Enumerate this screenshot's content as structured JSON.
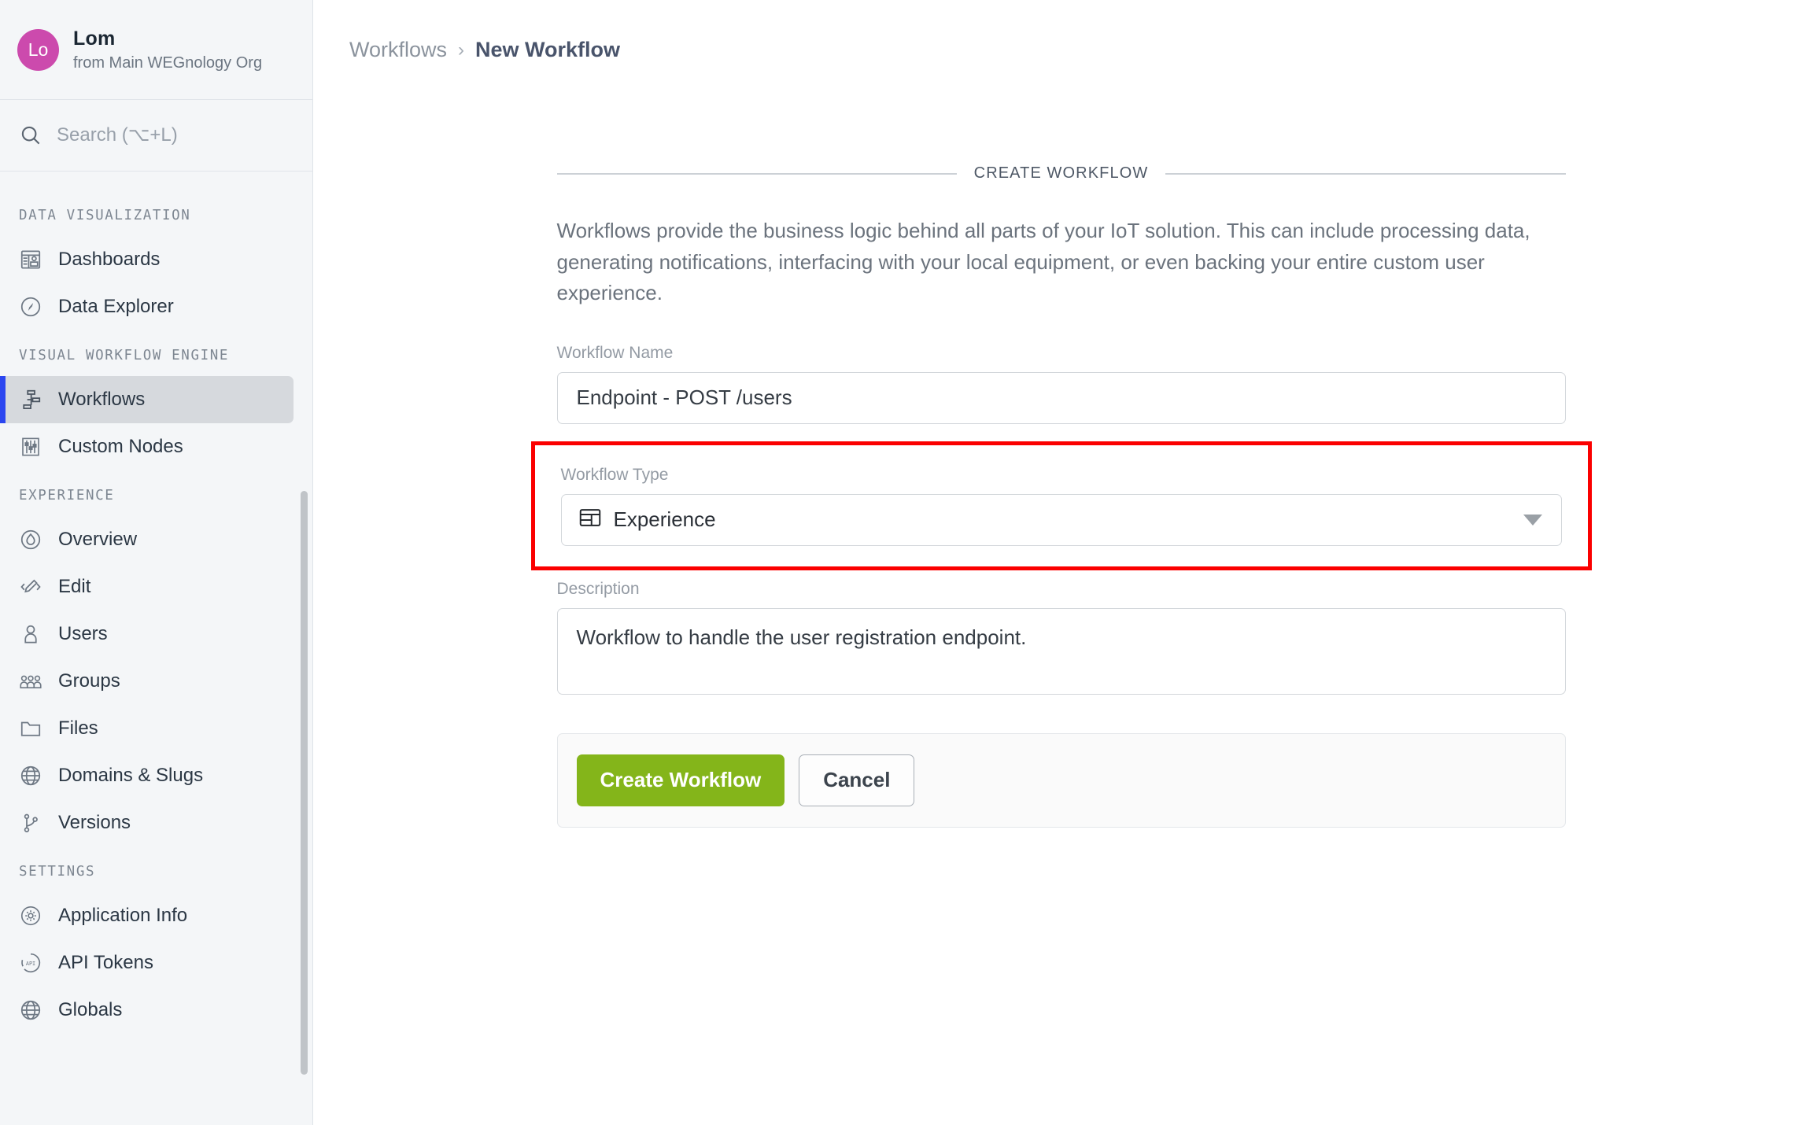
{
  "sidebar": {
    "org": {
      "avatar_initials": "Lo",
      "name": "Lom",
      "subtitle": "from Main WEGnology Org",
      "avatar_color": "#cc4aad"
    },
    "search": {
      "placeholder": "Search (⌥+L)",
      "value": "",
      "icon": "search-icon"
    },
    "sections": [
      {
        "title": "DATA VISUALIZATION",
        "items": [
          {
            "label": "Dashboards",
            "icon": "dashboard-icon",
            "active": false
          },
          {
            "label": "Data Explorer",
            "icon": "compass-icon",
            "active": false
          }
        ]
      },
      {
        "title": "VISUAL WORKFLOW ENGINE",
        "items": [
          {
            "label": "Workflows",
            "icon": "workflow-icon",
            "active": true
          },
          {
            "label": "Custom Nodes",
            "icon": "sliders-icon",
            "active": false
          }
        ]
      },
      {
        "title": "EXPERIENCE",
        "items": [
          {
            "label": "Overview",
            "icon": "flame-circle-icon",
            "active": false
          },
          {
            "label": "Edit",
            "icon": "code-pencil-icon",
            "active": false
          },
          {
            "label": "Users",
            "icon": "user-icon",
            "active": false
          },
          {
            "label": "Groups",
            "icon": "group-icon",
            "active": false
          },
          {
            "label": "Files",
            "icon": "folder-icon",
            "active": false
          },
          {
            "label": "Domains & Slugs",
            "icon": "globe-www-icon",
            "active": false
          },
          {
            "label": "Versions",
            "icon": "branch-icon",
            "active": false
          }
        ]
      },
      {
        "title": "SETTINGS",
        "items": [
          {
            "label": "Application Info",
            "icon": "gear-circle-icon",
            "active": false
          },
          {
            "label": "API Tokens",
            "icon": "api-circle-icon",
            "active": false
          },
          {
            "label": "Globals",
            "icon": "globe-icon",
            "active": false
          }
        ]
      }
    ],
    "active_accent_color": "#2b46f0"
  },
  "breadcrumb": {
    "parent": "Workflows",
    "separator": "›",
    "current": "New Workflow"
  },
  "form": {
    "legend": "CREATE WORKFLOW",
    "intro": "Workflows provide the business logic behind all parts of your IoT solution. This can include processing data, generating notifications, interfacing with your local equipment, or even backing your entire custom user experience.",
    "workflow_name": {
      "label": "Workflow Name",
      "value": "Endpoint - POST /users",
      "placeholder": ""
    },
    "workflow_type": {
      "label": "Workflow Type",
      "value": "Experience",
      "icon": "browser-window-icon",
      "highlight_color": "#fb0000",
      "caret": "chevron-down-icon"
    },
    "description": {
      "label": "Description",
      "value": "Workflow to handle the user registration endpoint.",
      "placeholder": ""
    },
    "actions": {
      "primary_label": "Create Workflow",
      "primary_color": "#84b51a",
      "secondary_label": "Cancel"
    }
  }
}
